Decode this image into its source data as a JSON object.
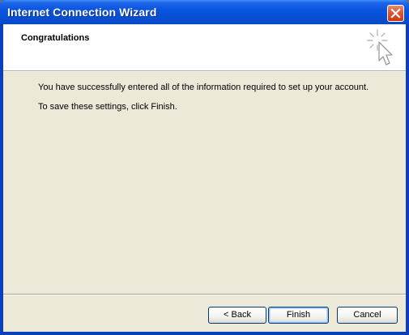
{
  "window": {
    "title": "Internet Connection Wizard"
  },
  "header": {
    "title": "Congratulations",
    "icon": "wizard-cursor-icon"
  },
  "body": {
    "line1": "You have successfully entered all of the information required to set up your account.",
    "line2": "To save these settings, click Finish."
  },
  "buttons": {
    "back": "< Back",
    "finish": "Finish",
    "cancel": "Cancel"
  },
  "colors": {
    "titlebar": "#0a55e0",
    "client": "#ece9d8",
    "close": "#e0552f"
  }
}
